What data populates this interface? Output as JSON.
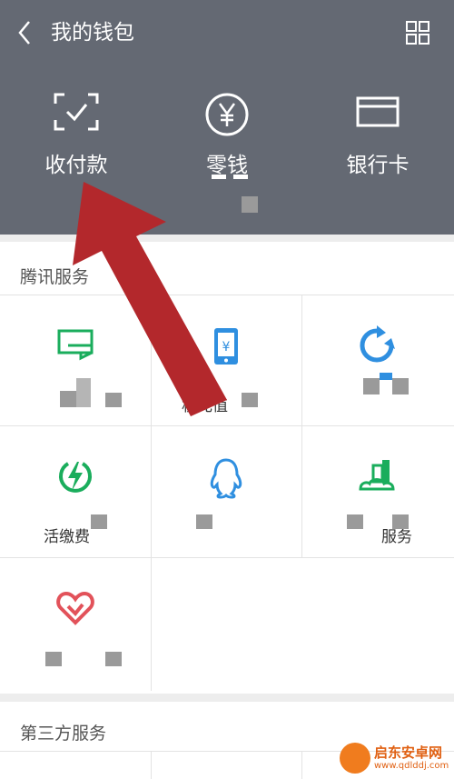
{
  "header": {
    "back_icon": "chevron-left-icon",
    "title": "我的钱包",
    "menu_icon": "grid-menu-icon",
    "actions": [
      {
        "label": "收付款",
        "icon": "scan-check-icon"
      },
      {
        "label": "零钱",
        "icon": "yen-circle-icon"
      },
      {
        "label": "银行卡",
        "icon": "bank-card-icon"
      }
    ]
  },
  "tencent_services": {
    "title": "腾讯服务",
    "items": [
      {
        "label": "",
        "icon": "wallet-card-icon",
        "color": "#1aad5c"
      },
      {
        "label": "机充值",
        "icon": "mobile-topup-icon",
        "color": "#2f8fe0"
      },
      {
        "label": "",
        "icon": "refresh-icon",
        "color": "#2f8fe0"
      },
      {
        "label": "活缴费",
        "icon": "lightning-icon",
        "color": "#1aad5c"
      },
      {
        "label": "",
        "icon": "qq-icon",
        "color": "#2f8fe0"
      },
      {
        "label": "服务",
        "icon": "city-icon",
        "color": "#1aad5c"
      },
      {
        "label": "",
        "icon": "heart-charity-icon",
        "color": "#e2525a"
      }
    ]
  },
  "third_party": {
    "title": "第三方服务"
  },
  "watermark": {
    "name": "启东安卓网",
    "url": "www.qdlddj.com"
  },
  "colors": {
    "header_bg": "#646973",
    "arrow": "#b3282c",
    "green": "#1aad5c",
    "blue": "#2f8fe0",
    "red": "#e2525a"
  }
}
